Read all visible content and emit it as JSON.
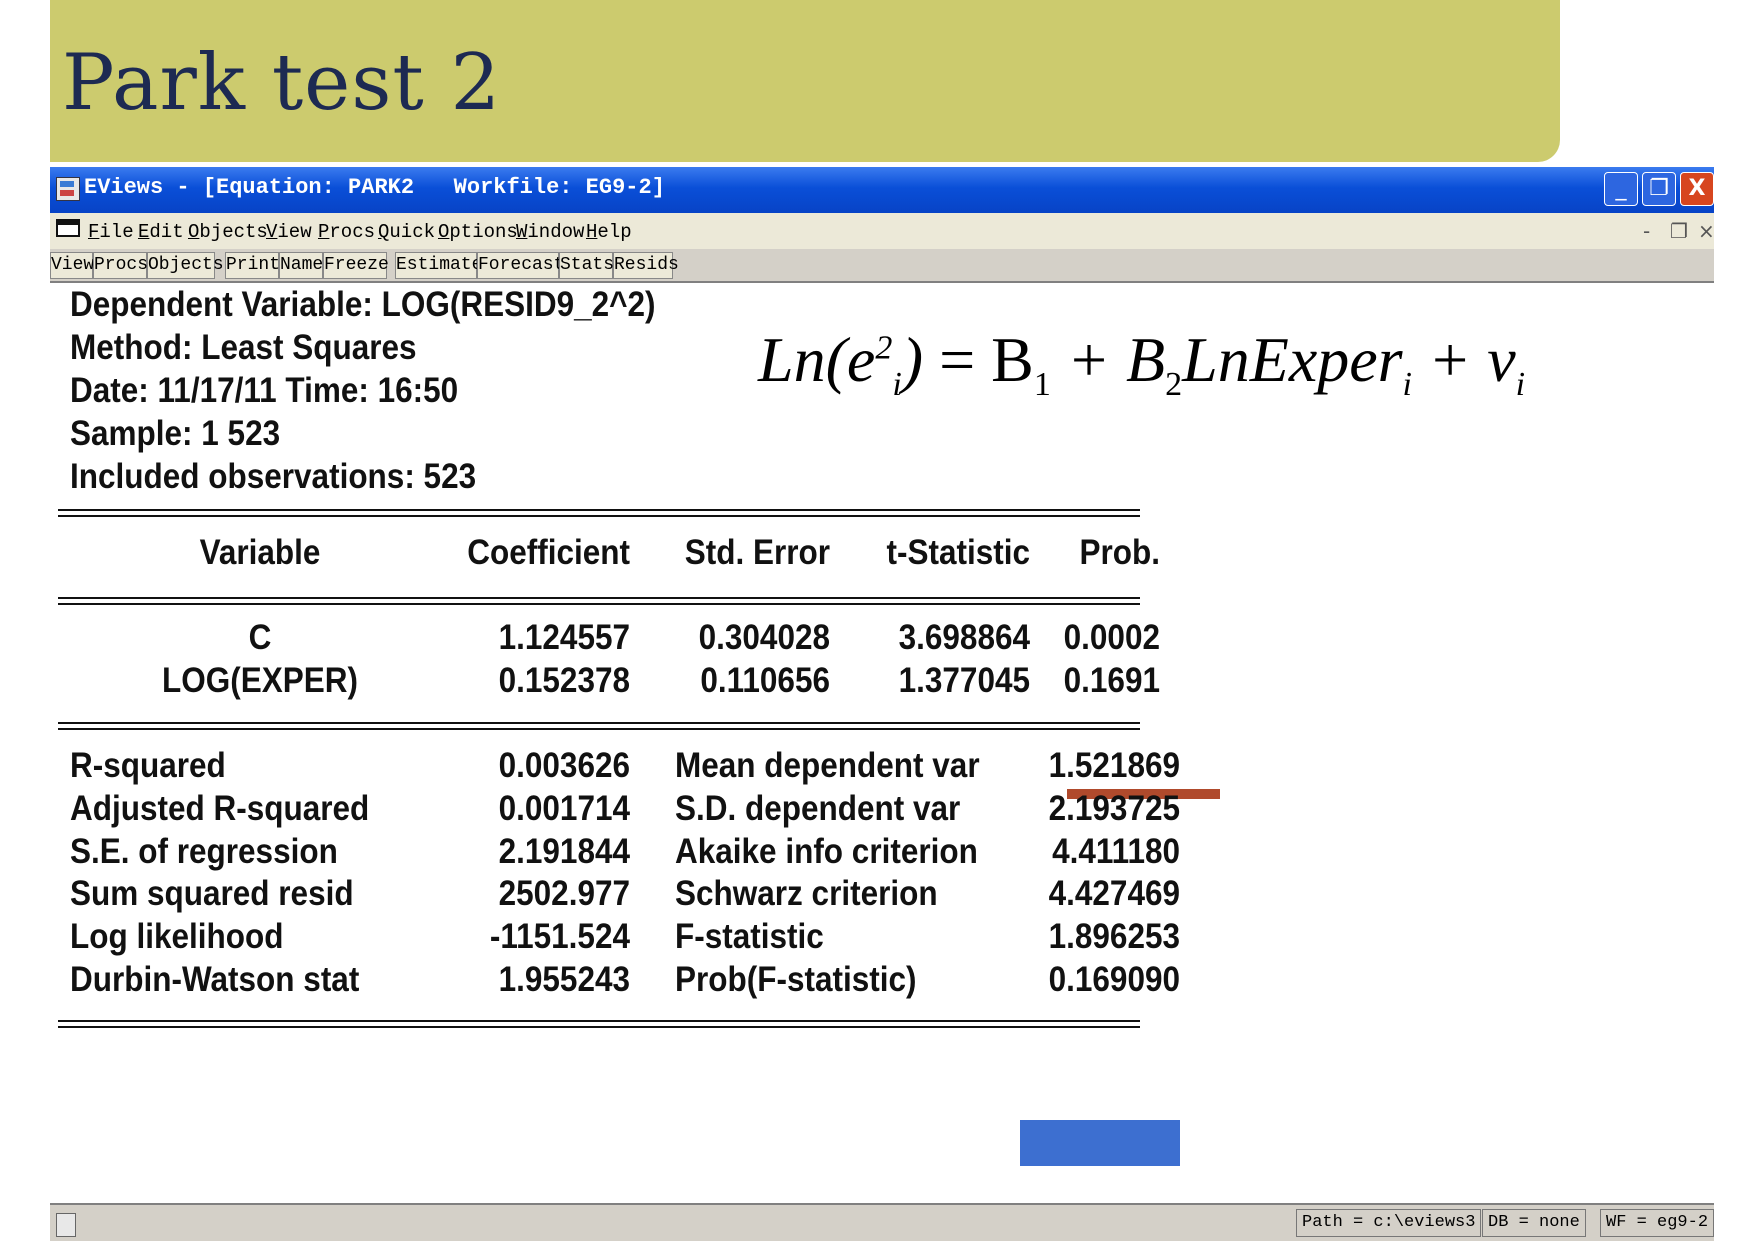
{
  "slide": {
    "title": "Park test 2"
  },
  "window": {
    "title": "EViews - [Equation: PARK2   Workfile: EG9-2]",
    "controls": {
      "minimize": "_",
      "maximize": "❐",
      "close": "X"
    }
  },
  "menu": [
    "File",
    "Edit",
    "Objects",
    "View",
    "Procs",
    "Quick",
    "Options",
    "Window",
    "Help"
  ],
  "mdi_controls": [
    "-",
    "❐",
    "×"
  ],
  "toolbar": [
    "View",
    "Procs",
    "Objects",
    "Print",
    "Name",
    "Freeze",
    "Estimate",
    "Forecast",
    "Stats",
    "Resids"
  ],
  "output": {
    "header": [
      "Dependent Variable: LOG(RESID9_2^2)",
      "Method: Least Squares",
      "Date: 11/17/11   Time: 16:50",
      "Sample: 1 523",
      "Included observations: 523"
    ],
    "formula": {
      "lhs": "Ln(e",
      "lhs_sup": "2",
      "lhs_sub": "i",
      "lhs_close": ")",
      "eq": " = B",
      "b1_sub": "1",
      "plus1": " + B",
      "b2_sub": "2",
      "term": "LnExper",
      "term_sub": "i",
      "plus2": " + v",
      "v_sub": "i"
    },
    "coef_table": {
      "columns": [
        "Variable",
        "Coefficient",
        "Std. Error",
        "t-Statistic",
        "Prob."
      ],
      "rows": [
        [
          "C",
          "1.124557",
          "0.304028",
          "3.698864",
          "0.0002"
        ],
        [
          "LOG(EXPER)",
          "0.152378",
          "0.110656",
          "1.377045",
          "0.1691"
        ]
      ]
    },
    "stats": [
      [
        "R-squared",
        "0.003626",
        "Mean dependent var",
        "1.521869"
      ],
      [
        "Adjusted R-squared",
        "0.001714",
        "S.D. dependent var",
        "2.193725"
      ],
      [
        "S.E. of regression",
        "2.191844",
        "Akaike info criterion",
        "4.411180"
      ],
      [
        "Sum squared resid",
        "2502.977",
        "Schwarz criterion",
        "4.427469"
      ],
      [
        "Log likelihood",
        "-1151.524",
        "F-statistic",
        "1.896253"
      ],
      [
        "Durbin-Watson stat",
        "1.955243",
        "Prob(F-statistic)",
        "0.169090"
      ]
    ]
  },
  "status": {
    "path": "Path = c:\\eviews3",
    "db": "DB = none",
    "wf": "WF = eg9-2"
  },
  "colors": {
    "banner": "#cccb6e",
    "title_text": "#1d2a52",
    "titlebar": "#0a4fd8",
    "highlight_red": "#b04a2c",
    "highlight_blue": "#3d6fd0"
  }
}
